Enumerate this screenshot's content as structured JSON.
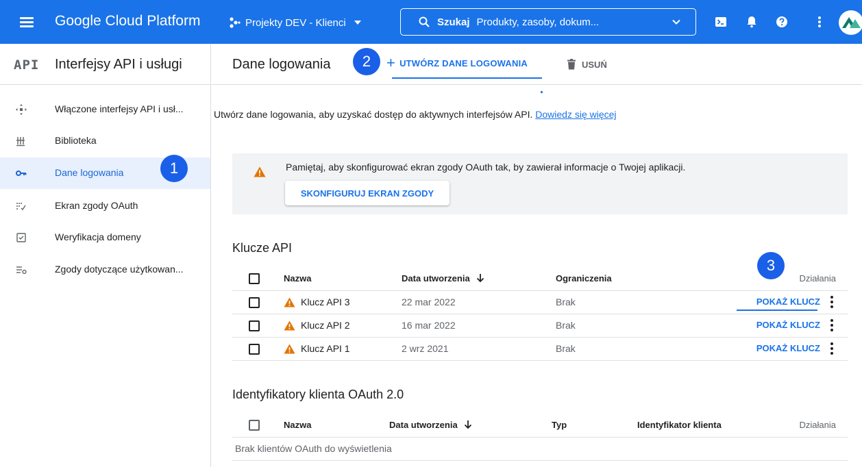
{
  "topbar": {
    "brand": "Google Cloud Platform",
    "project": "Projekty DEV - Klienci",
    "search_keyword": "Szukaj",
    "search_placeholder": "Produkty, zasoby, dokum...",
    "icons": [
      "menu-icon",
      "project-dots-icon",
      "search-icon",
      "terminal-icon",
      "bell-icon",
      "help-icon",
      "more-vert-icon",
      "avatar"
    ]
  },
  "sidebar": {
    "api_badge": "API",
    "title": "Interfejsy API i usługi",
    "items": [
      {
        "label": "Włączone interfejsy API i usł...",
        "icon": "apis-icon"
      },
      {
        "label": "Biblioteka",
        "icon": "library-icon"
      },
      {
        "label": "Dane logowania",
        "icon": "key-icon",
        "active": true
      },
      {
        "label": "Ekran zgody OAuth",
        "icon": "oauth-icon"
      },
      {
        "label": "Weryfikacja domeny",
        "icon": "domain-check-icon"
      },
      {
        "label": "Zgody dotyczące użytkowan...",
        "icon": "consent-settings-icon"
      }
    ]
  },
  "main": {
    "title": "Dane logowania",
    "create_label": "UTWÓRZ DANE LOGOWANIA",
    "delete_label": "USUŃ",
    "intro_text": "Utwórz dane logowania, aby uzyskać dostęp do aktywnych interfejsów API.",
    "intro_link": "Dowiedz się więcej",
    "warning": {
      "text": "Pamiętaj, aby skonfigurować ekran zgody OAuth tak, by zawierał informacje o Twojej aplikacji.",
      "button": "SKONFIGURUJ EKRAN ZGODY"
    },
    "api_keys": {
      "title": "Klucze API",
      "headers": {
        "name": "Nazwa",
        "created": "Data utworzenia",
        "restrictions": "Ograniczenia",
        "actions": "Działania"
      },
      "rows": [
        {
          "name": "Klucz API 3",
          "created": "22 mar 2022",
          "restrictions": "Brak",
          "action": "POKAŻ KLUCZ"
        },
        {
          "name": "Klucz API 2",
          "created": "16 mar 2022",
          "restrictions": "Brak",
          "action": "POKAŻ KLUCZ"
        },
        {
          "name": "Klucz API 1",
          "created": "2 wrz 2021",
          "restrictions": "Brak",
          "action": "POKAŻ KLUCZ"
        }
      ]
    },
    "oauth": {
      "title": "Identyfikatory klienta OAuth 2.0",
      "headers": {
        "name": "Nazwa",
        "created": "Data utworzenia",
        "type": "Typ",
        "client_id": "Identyfikator klienta",
        "actions": "Działania"
      },
      "empty": "Brak klientów OAuth do wyświetlenia"
    }
  },
  "annotations": [
    "1",
    "2",
    "3"
  ],
  "colors": {
    "topbar": "#1a73e8",
    "accent": "#1a73e8",
    "active_bg": "#e8f0fe",
    "warning": "#e37400",
    "badge": "#1a5fe8"
  }
}
